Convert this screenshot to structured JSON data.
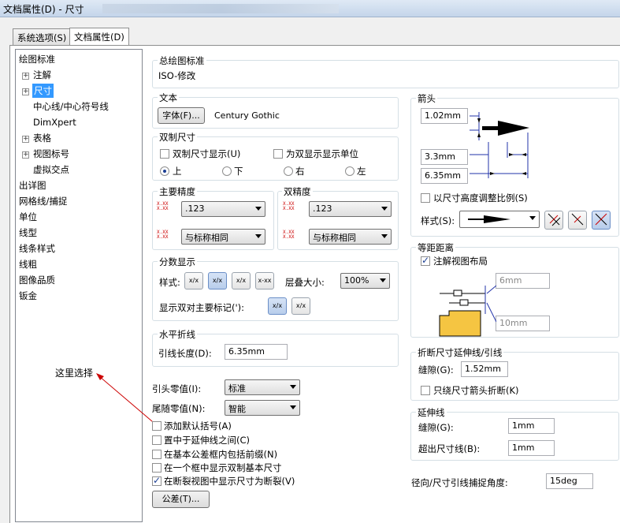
{
  "window": {
    "title": "文档属性(D) - 尺寸"
  },
  "tabs": [
    {
      "label": "系统选项(S)"
    },
    {
      "label": "文档属性(D)"
    }
  ],
  "tree": {
    "items": [
      {
        "label": "绘图标准"
      },
      {
        "label": "注解"
      },
      {
        "label": "尺寸"
      },
      {
        "label": "中心线/中心符号线"
      },
      {
        "label": "DimXpert"
      },
      {
        "label": "表格"
      },
      {
        "label": "视图标号"
      },
      {
        "label": "虚拟交点"
      },
      {
        "label": "出详图"
      },
      {
        "label": "网格线/捕捉"
      },
      {
        "label": "单位"
      },
      {
        "label": "线型"
      },
      {
        "label": "线条样式"
      },
      {
        "label": "线粗"
      },
      {
        "label": "图像品质"
      },
      {
        "label": "钣金"
      }
    ]
  },
  "overall_standard": {
    "title": "总绘图标准",
    "value": "ISO-修改"
  },
  "text": {
    "title": "文本",
    "font_button": "字体(F)...",
    "font_name": "Century Gothic"
  },
  "dual": {
    "title": "双制尺寸",
    "show_dual": "双制尺寸显示(U)",
    "show_units": "为双显示显示单位",
    "top": "上",
    "bottom": "下",
    "right": "右",
    "left": "左"
  },
  "primary_precision": {
    "title": "主要精度",
    "value1": ".123",
    "value2": "与标称相同"
  },
  "dual_precision": {
    "title": "双精度",
    "value1": ".123",
    "value2": "与标称相同"
  },
  "fraction": {
    "title": "分数显示",
    "style_label": "样式:",
    "stack_label": "层叠大小:",
    "stack_value": "100%",
    "show_dual_mark": "显示双对主要标记('):",
    "icons": [
      "x/x",
      "x/x",
      "x/x",
      "x-xx"
    ]
  },
  "horizontal_break": {
    "title": "水平折线",
    "leader_label": "引线长度(D):",
    "leader_value": "6.35mm"
  },
  "zeros": {
    "leading_label": "引头零值(I):",
    "leading_value": "标准",
    "trailing_label": "尾随零值(N):",
    "trailing_value": "智能"
  },
  "options": [
    {
      "label": "添加默认括号(A)",
      "checked": false
    },
    {
      "label": "置中于延伸线之间(C)",
      "checked": false
    },
    {
      "label": "在基本公差框内包括前缀(N)",
      "checked": false
    },
    {
      "label": "在一个框中显示双制基本尺寸",
      "checked": false
    },
    {
      "label": "在断裂视图中显示尺寸为断裂(V)",
      "checked": true
    }
  ],
  "tolerance_button": "公差(T)...",
  "annotation": {
    "text": "这里选择",
    "color": "#cc0000"
  },
  "arrows": {
    "title": "箭头",
    "v1": "1.02mm",
    "v2": "3.3mm",
    "v3": "6.35mm",
    "scale_label": "以尺寸高度调整比例(S)",
    "style_label": "样式(S):"
  },
  "offset": {
    "title": "等距距离",
    "layout": "注解视图布局",
    "v1": "6mm",
    "v2": "10mm"
  },
  "break": {
    "title": "折断尺寸延伸线/引线",
    "gap_label": "缝隙(G):",
    "gap_value": "1.52mm",
    "only_arrow": "只绕尺寸箭头折断(K)"
  },
  "extension": {
    "title": "延伸线",
    "gap_label": "缝隙(G):",
    "gap_value": "1mm",
    "beyond_label": "超出尺寸线(B):",
    "beyond_value": "1mm"
  },
  "radial": {
    "label": "径向/尺寸引线捕捉角度:",
    "value": "15deg"
  },
  "colors": {
    "selection": "#3399ff",
    "annotation": "#cc0000"
  }
}
